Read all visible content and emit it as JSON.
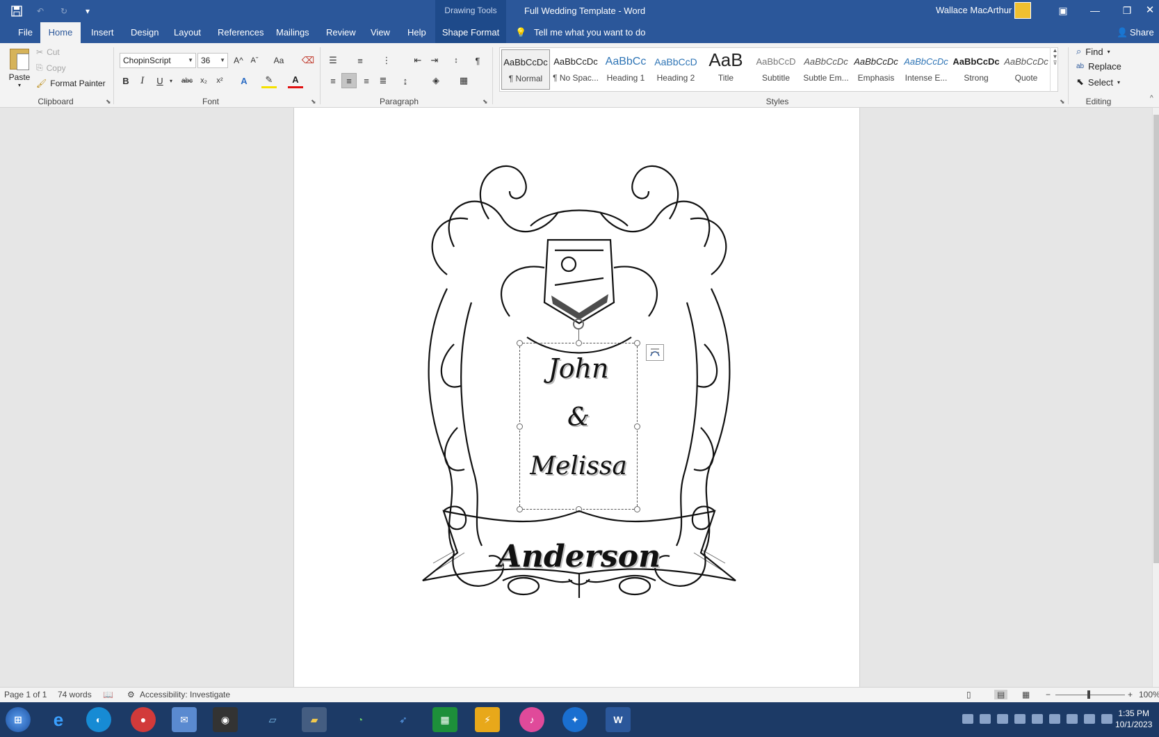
{
  "titlebar": {
    "context_label": "Drawing Tools",
    "doc_title": "Full Wedding Template  -  Word",
    "user_name": "Wallace MacArthur"
  },
  "tabs": {
    "file": "File",
    "home": "Home",
    "insert": "Insert",
    "design": "Design",
    "layout": "Layout",
    "references": "References",
    "mailings": "Mailings",
    "review": "Review",
    "view": "View",
    "help": "Help",
    "shape_format": "Shape Format",
    "tell_me": "Tell me what you want to do",
    "share": "Share"
  },
  "clipboard": {
    "paste": "Paste",
    "cut": "Cut",
    "copy": "Copy",
    "format_painter": "Format Painter",
    "label": "Clipboard"
  },
  "font": {
    "family": "ChopinScript",
    "size": "36",
    "label": "Font",
    "bold": "B",
    "italic": "I",
    "underline": "U",
    "strike": "abc",
    "subscript": "x₂",
    "superscript": "x²",
    "grow": "A^",
    "shrink": "Aˇ",
    "change_case": "Aa"
  },
  "paragraph": {
    "label": "Paragraph"
  },
  "styles": {
    "label": "Styles",
    "items": [
      {
        "sample": "AaBbCcDc",
        "name": "¶ Normal"
      },
      {
        "sample": "AaBbCcDc",
        "name": "¶ No Spac..."
      },
      {
        "sample": "AaBbCc",
        "name": "Heading 1"
      },
      {
        "sample": "AaBbCcD",
        "name": "Heading 2"
      },
      {
        "sample": "AaB",
        "name": "Title"
      },
      {
        "sample": "AaBbCcD",
        "name": "Subtitle"
      },
      {
        "sample": "AaBbCcDc",
        "name": "Subtle Em..."
      },
      {
        "sample": "AaBbCcDc",
        "name": "Emphasis"
      },
      {
        "sample": "AaBbCcDc",
        "name": "Intense E..."
      },
      {
        "sample": "AaBbCcDc",
        "name": "Strong"
      },
      {
        "sample": "AaBbCcDc",
        "name": "Quote"
      }
    ]
  },
  "editing": {
    "label": "Editing",
    "find": "Find",
    "replace": "Replace",
    "select": "Select"
  },
  "document": {
    "first_name": "John",
    "ampersand": "&",
    "second_name": "Melissa",
    "surname": "Anderson"
  },
  "status": {
    "page": "Page 1 of 1",
    "words": "74 words",
    "accessibility": "Accessibility: Investigate",
    "zoom": "100%"
  },
  "taskbar": {
    "time": "1:35 PM",
    "date": "10/1/2023"
  },
  "colors": {
    "word_blue": "#2b579a",
    "ribbon_bg": "#f3f3f3",
    "taskbar": "#1c3a66"
  }
}
